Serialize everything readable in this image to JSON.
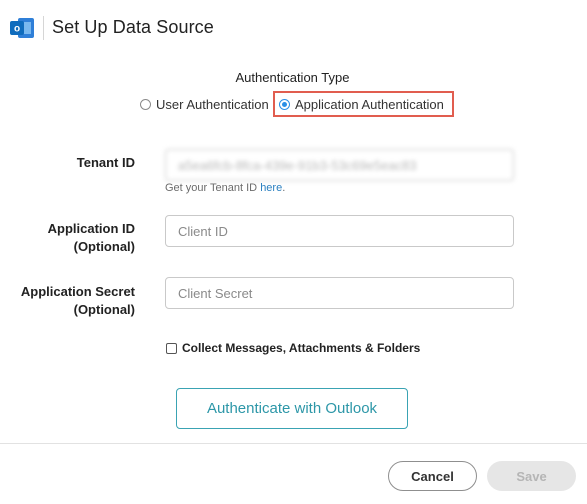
{
  "header": {
    "title": "Set Up Data Source",
    "logo_icon": "outlook-logo-icon",
    "logo_letter": "o",
    "brand_color": "#0f6cbd"
  },
  "auth_type": {
    "label": "Authentication Type",
    "options": [
      {
        "label": "User Authentication",
        "selected": false
      },
      {
        "label": "Application Authentication",
        "selected": true
      }
    ],
    "highlight_color": "#e15d4f"
  },
  "fields": {
    "tenant_id": {
      "label": "Tenant ID",
      "value": "a5ea6fcb-8fca-439e-91b3-53c69e5eac83",
      "helper_prefix": "Get your Tenant ID ",
      "helper_link": "here",
      "helper_suffix": "."
    },
    "application_id": {
      "label_line1": "Application ID",
      "label_line2": "(Optional)",
      "placeholder": "Client ID"
    },
    "application_secret": {
      "label_line1": "Application Secret",
      "label_line2": "(Optional)",
      "placeholder": "Client Secret"
    }
  },
  "collect": {
    "label": "Collect Messages, Attachments & Folders",
    "checked": false
  },
  "actions": {
    "authenticate_label": "Authenticate with Outlook",
    "cancel_label": "Cancel",
    "save_label": "Save"
  },
  "colors": {
    "accent": "#2d97a8",
    "radio_selected": "#2a8fe6",
    "link": "#2a7fc0"
  }
}
